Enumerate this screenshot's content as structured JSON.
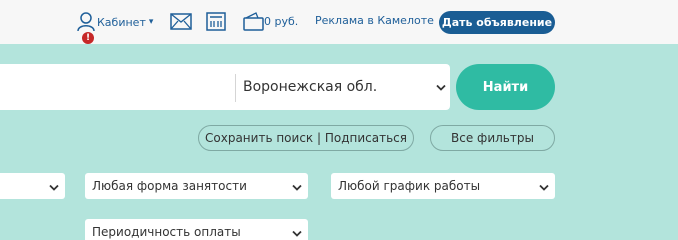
{
  "topbar": {
    "cabinet_label": "Кабинет",
    "caret": "▾",
    "alert_badge": "!",
    "balance": "0 руб.",
    "ads_link": "Реклама в Камелоте",
    "post_button": "Дать объявление"
  },
  "search": {
    "region": "Воронежская обл.",
    "find_button": "Найти"
  },
  "actions": {
    "save_search": "Сохранить поиск | Подписаться",
    "all_filters": "Все фильтры"
  },
  "filters": {
    "select_1": "",
    "employment_form": "Любая форма занятости",
    "work_schedule": "Любой график работы",
    "pay_frequency": "Периодичность оплаты"
  },
  "colors": {
    "background": "#b3e4dc",
    "link": "#1f5f99",
    "post_button": "#1a5d94",
    "find_button": "#2fbba3",
    "alert": "#c62828"
  },
  "icons": [
    "user-icon",
    "mail-icon",
    "calculator-icon",
    "wallet-icon",
    "chevron-down-icon"
  ]
}
